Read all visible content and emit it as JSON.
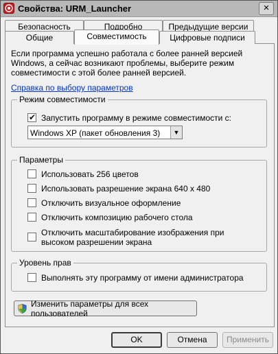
{
  "window": {
    "title": "Свойства: URM_Launcher",
    "close_glyph": "×"
  },
  "tabs": {
    "back_row": [
      "Безопасность",
      "Подробно",
      "Предыдущие версии"
    ],
    "front_row": [
      "Общие",
      "Совместимость",
      "Цифровые подписи"
    ],
    "active": "Совместимость"
  },
  "intro": {
    "line1": "Если программа успешно работала с более ранней версией",
    "line2": "Windows, а сейчас возникают проблемы, выберите режим",
    "line3": "совместимости с этой более ранней версией.",
    "help_link": "Справка по выбору параметров"
  },
  "compat_mode": {
    "legend": "Режим совместимости",
    "run_in_compat_label": "Запустить программу в режиме совместимости с:",
    "run_in_compat_checked": true,
    "os_selected": "Windows XP (пакет обновления 3)",
    "dropdown_glyph": "▼"
  },
  "settings": {
    "legend": "Параметры",
    "items": [
      {
        "label": "Использовать 256 цветов",
        "checked": false
      },
      {
        "label": "Использовать разрешение экрана 640 x 480",
        "checked": false
      },
      {
        "label": "Отключить визуальное оформление",
        "checked": false
      },
      {
        "label": "Отключить композицию рабочего стола",
        "checked": false
      },
      {
        "label_line1": "Отключить масштабирование изображения при",
        "label_line2": "высоком разрешении экрана",
        "checked": false
      }
    ]
  },
  "privilege": {
    "legend": "Уровень прав",
    "run_as_admin_label": "Выполнять эту программу от имени администратора",
    "run_as_admin_checked": false
  },
  "all_users_button": "Изменить параметры для всех пользователей",
  "footer": {
    "ok": "OK",
    "cancel": "Отмена",
    "apply": "Применить"
  }
}
